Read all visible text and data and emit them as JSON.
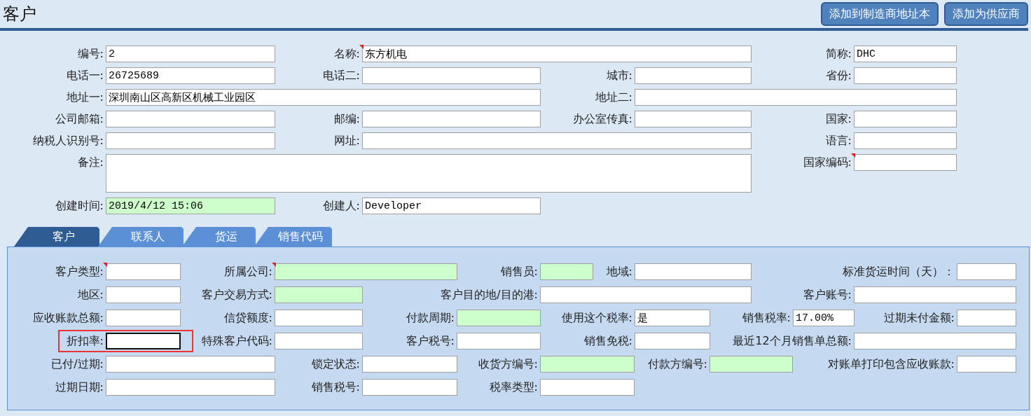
{
  "header": {
    "title": "客户",
    "buttons": [
      "添加到制造商地址本",
      "添加为供应商"
    ]
  },
  "fields": [
    [
      {
        "label": "编号:",
        "value": "2",
        "kind": "text",
        "required": false,
        "focused": false,
        "highlighted": false
      },
      {
        "label": "名称:",
        "value": "东方机电",
        "kind": "text",
        "required": true,
        "focused": false,
        "highlighted": false
      },
      {
        "label": "简称:",
        "value": "DHC",
        "kind": "text",
        "required": false,
        "focused": false,
        "highlighted": false
      }
    ],
    [
      {
        "label": "电话一:",
        "value": "26725689",
        "kind": "text",
        "required": false,
        "focused": false,
        "highlighted": false
      },
      {
        "label": "电话二:",
        "kind": "text",
        "required": false,
        "focused": false,
        "highlighted": false
      },
      {
        "label": "城市:",
        "kind": "text",
        "required": false,
        "focused": false,
        "highlighted": false
      },
      {
        "label": "省份:",
        "kind": "text",
        "required": false,
        "focused": false,
        "highlighted": false
      }
    ],
    [
      {
        "label": "地址一:",
        "value": "深圳南山区高新区机械工业园区",
        "kind": "text",
        "required": false,
        "focused": false,
        "highlighted": false
      },
      {
        "label": "地址二:",
        "kind": "text",
        "required": false,
        "focused": false,
        "highlighted": false
      }
    ],
    [
      {
        "label": "公司邮箱:",
        "kind": "text",
        "required": false,
        "focused": false,
        "highlighted": false
      },
      {
        "label": "邮编:",
        "kind": "text",
        "required": false,
        "focused": false,
        "highlighted": false
      },
      {
        "label": "办公室传真:",
        "kind": "text",
        "required": false,
        "focused": false,
        "highlighted": false
      },
      {
        "label": "国家:",
        "kind": "text",
        "required": false,
        "focused": false,
        "highlighted": false
      }
    ],
    [
      {
        "label": "纳税人识别号:",
        "kind": "text",
        "required": false,
        "focused": false,
        "highlighted": false
      },
      {
        "label": "网址:",
        "kind": "text",
        "required": false,
        "focused": false,
        "highlighted": false
      },
      {
        "label": "语言:",
        "kind": "text",
        "required": false,
        "focused": false,
        "highlighted": false
      }
    ],
    [
      {
        "label": "备注:",
        "kind": "textarea",
        "required": false,
        "focused": false,
        "highlighted": false
      },
      {
        "label": "国家编码:",
        "kind": "text",
        "required": true,
        "focused": false,
        "highlighted": false
      }
    ],
    [
      {
        "label": "创建时间:",
        "value": "2019/4/12 15:06",
        "kind": "readonly",
        "required": false,
        "focused": false,
        "highlighted": false
      },
      {
        "label": "创建人:",
        "value": "Developer",
        "kind": "text",
        "required": false,
        "focused": false,
        "highlighted": false
      }
    ]
  ],
  "tabs": [
    {
      "label": "客户",
      "selected": true
    },
    {
      "label": "联系人",
      "selected": false
    },
    {
      "label": "货运",
      "selected": false
    },
    {
      "label": "销售代码",
      "selected": false
    }
  ],
  "tab_fields": [
    [
      {
        "label": "客户类型:",
        "kind": "text",
        "required": true,
        "focused": false,
        "highlighted": false
      },
      {
        "label": "所属公司:",
        "kind": "readonly",
        "required": true,
        "focused": false,
        "highlighted": false
      },
      {
        "label": "销售员:",
        "kind": "readonly",
        "required": false,
        "focused": false,
        "highlighted": false
      },
      {
        "label": "地域:",
        "kind": "text",
        "required": false,
        "focused": false,
        "highlighted": false
      },
      {
        "label": "标准货运时间（天）：",
        "kind": "text",
        "required": false,
        "focused": false,
        "highlighted": false
      }
    ],
    [
      {
        "label": "地区:",
        "kind": "text",
        "required": false,
        "focused": false,
        "highlighted": false
      },
      {
        "label": "客户交易方式:",
        "kind": "readonly",
        "required": false,
        "focused": false,
        "highlighted": false
      },
      {
        "label": "客户目的地/目的港:",
        "kind": "text",
        "required": false,
        "focused": false,
        "highlighted": false
      },
      {
        "label": "客户账号:",
        "kind": "text",
        "required": false,
        "focused": false,
        "highlighted": false
      }
    ],
    [
      {
        "label": "应收账款总额:",
        "kind": "text",
        "required": false,
        "focused": false,
        "highlighted": false
      },
      {
        "label": "信贷额度:",
        "kind": "text",
        "required": false,
        "focused": false,
        "highlighted": false
      },
      {
        "label": "付款周期:",
        "kind": "readonly",
        "required": false,
        "focused": false,
        "highlighted": false
      },
      {
        "label": "使用这个税率:",
        "value": "是",
        "kind": "text",
        "required": false,
        "focused": false,
        "highlighted": false
      },
      {
        "label": "销售税率:",
        "value": "17.00%",
        "kind": "text",
        "required": false,
        "focused": false,
        "highlighted": false
      },
      {
        "label": "过期未付金额:",
        "kind": "text",
        "required": false,
        "focused": false,
        "highlighted": false
      }
    ],
    [
      {
        "label": "折扣率:",
        "kind": "text",
        "required": false,
        "focused": true,
        "highlighted": true
      },
      {
        "label": "特殊客户代码:",
        "kind": "text",
        "required": false,
        "focused": false,
        "highlighted": false
      },
      {
        "label": "客户税号:",
        "kind": "text",
        "required": false,
        "focused": false,
        "highlighted": false
      },
      {
        "label": "销售免税:",
        "kind": "text",
        "required": false,
        "focused": false,
        "highlighted": false
      },
      {
        "label": "最近12个月销售单总额:",
        "kind": "text",
        "required": false,
        "focused": false,
        "highlighted": false
      }
    ],
    [
      {
        "label": "已付/过期:",
        "kind": "text",
        "required": false,
        "focused": false,
        "highlighted": false
      },
      {
        "label": "锁定状态:",
        "kind": "text",
        "required": false,
        "focused": false,
        "highlighted": false
      },
      {
        "label": "收货方编号:",
        "kind": "readonly",
        "required": false,
        "focused": false,
        "highlighted": false
      },
      {
        "label": "付款方编号:",
        "kind": "readonly",
        "required": false,
        "focused": false,
        "highlighted": false
      },
      {
        "label": "对账单打印包含应收账款:",
        "kind": "text",
        "required": false,
        "focused": false,
        "highlighted": false
      }
    ],
    [
      {
        "label": "过期日期:",
        "kind": "text",
        "required": false,
        "focused": false,
        "highlighted": false
      },
      {
        "label": "销售税号:",
        "kind": "text",
        "required": false,
        "focused": false,
        "highlighted": false
      },
      {
        "label": "税率类型:",
        "kind": "text",
        "required": false,
        "focused": false,
        "highlighted": false
      }
    ]
  ]
}
